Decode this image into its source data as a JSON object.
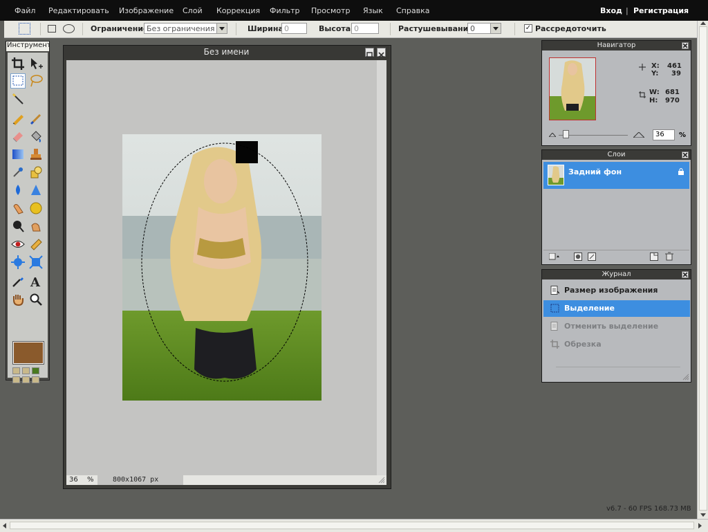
{
  "menu": {
    "items": [
      "Файл",
      "Редактировать",
      "Изображение",
      "Слой",
      "Коррекция",
      "Фильтр",
      "Просмотр",
      "Язык",
      "Справка"
    ],
    "login": "Вход",
    "separator": "|",
    "register": "Регистрация"
  },
  "options": {
    "constraint_label": "Ограничение:",
    "constraint_value": "Без ограничения",
    "width_label": "Ширина:",
    "width_value": "0",
    "height_label": "Высота:",
    "height_value": "0",
    "feather_label": "Растушевывание:",
    "feather_value": "0",
    "antialias_checked": true,
    "antialias_label": "Рассредоточить"
  },
  "toolbox": {
    "title": "Инструменты",
    "selected_tool": "marquee-tool",
    "primary_color": "#8a5a2c"
  },
  "document": {
    "title": "Без имени",
    "zoom_value": "36",
    "zoom_unit": "%",
    "size_text": "800x1067 px"
  },
  "navigator": {
    "title": "Навигатор",
    "x_label": "X:",
    "x_value": "461",
    "y_label": "Y:",
    "y_value": "39",
    "w_label": "W:",
    "w_value": "681",
    "h_label": "H:",
    "h_value": "970",
    "zoom_value": "36",
    "zoom_unit": "%"
  },
  "layers": {
    "title": "Слои",
    "items": [
      {
        "name": "Задний фон",
        "locked": true
      }
    ]
  },
  "history": {
    "title": "Журнал",
    "items": [
      {
        "label": "Размер изображения",
        "state": "normal"
      },
      {
        "label": "Выделение",
        "state": "selected"
      },
      {
        "label": "Отменить выделение",
        "state": "undone"
      },
      {
        "label": "Обрезка",
        "state": "undone"
      }
    ]
  },
  "status": {
    "fps": "v6.7 - 60 FPS 168.73 MB"
  },
  "colors": {
    "menubar": "#0e0e0e",
    "workspace": "#5d5e5a",
    "selection_highlight": "#3d8ee0"
  }
}
